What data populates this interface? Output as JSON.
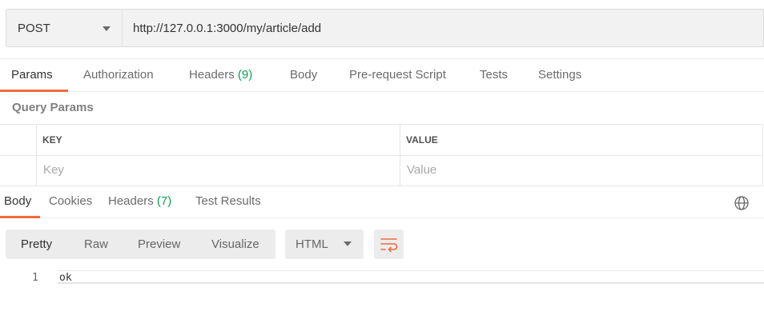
{
  "request": {
    "method": "POST",
    "url": "http://127.0.0.1:3000/my/article/add"
  },
  "request_tabs": [
    {
      "label": "Params",
      "active": true
    },
    {
      "label": "Authorization"
    },
    {
      "label": "Headers",
      "count": "(9)"
    },
    {
      "label": "Body"
    },
    {
      "label": "Pre-request Script"
    },
    {
      "label": "Tests"
    },
    {
      "label": "Settings"
    }
  ],
  "query_params": {
    "title": "Query Params",
    "key_header": "KEY",
    "value_header": "VALUE",
    "key_placeholder": "Key",
    "value_placeholder": "Value"
  },
  "response_tabs": [
    {
      "label": "Body",
      "active": true
    },
    {
      "label": "Cookies"
    },
    {
      "label": "Headers",
      "count": "(7)"
    },
    {
      "label": "Test Results"
    }
  ],
  "view_modes": [
    "Pretty",
    "Raw",
    "Preview",
    "Visualize"
  ],
  "format": "HTML",
  "response_body": {
    "line_number": "1",
    "text": "ok"
  },
  "icons": {
    "globe": "globe-icon",
    "wrap": "wrap-lines-icon",
    "method_caret": "chevron-down-icon",
    "format_caret": "chevron-down-icon"
  },
  "colors": {
    "accent": "#f26b3a",
    "count": "#0f9d58"
  }
}
